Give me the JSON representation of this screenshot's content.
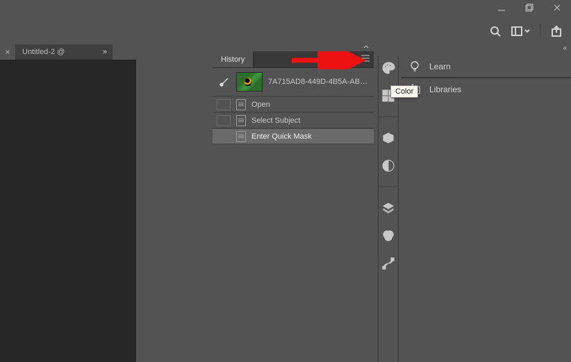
{
  "window": {
    "min": "minimize",
    "max": "restore",
    "close": "close"
  },
  "options": {
    "search": "search",
    "arrange": "arrange-documents",
    "share": "share"
  },
  "doc": {
    "close_x": "×",
    "tab_title": "Untitled-2 @",
    "expand": "»"
  },
  "history": {
    "tab": "History",
    "source_label": "7A715AD8-449D-4B5A-ABA2C...",
    "rows": [
      {
        "label": "Open",
        "selected": false
      },
      {
        "label": "Select Subject",
        "selected": false
      },
      {
        "label": "Enter Quick Mask",
        "selected": true
      }
    ]
  },
  "icon_strip": [
    "color-palette-icon",
    "swatches-icon",
    "3d-icon",
    "adjustments-icon",
    "layers-icon",
    "channels-icon",
    "paths-icon"
  ],
  "right_panels": {
    "learn": "Learn",
    "libraries": "Libraries"
  },
  "tooltip": {
    "color": "Color"
  },
  "annotation": {
    "arrow": "red-arrow"
  }
}
